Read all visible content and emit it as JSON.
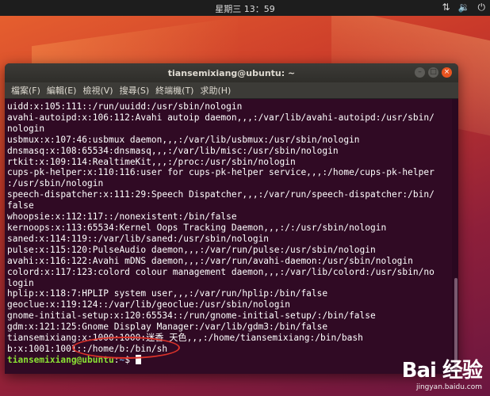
{
  "topbar": {
    "clock": "星期三 13：59",
    "tray": [
      "network-icon",
      "volume-icon",
      "power-icon"
    ]
  },
  "window": {
    "title": "tiansemixiang@ubuntu: ~",
    "buttons": [
      "minimize",
      "maximize",
      "close"
    ],
    "menu": [
      "檔案(F)",
      "編輯(E)",
      "檢視(V)",
      "搜尋(S)",
      "終端機(T)",
      "求助(H)"
    ]
  },
  "terminal": {
    "lines": [
      "uidd:x:105:111::/run/uuidd:/usr/sbin/nologin",
      "avahi-autoipd:x:106:112:Avahi autoip daemon,,,:/var/lib/avahi-autoipd:/usr/sbin/",
      "nologin",
      "usbmux:x:107:46:usbmux daemon,,,:/var/lib/usbmux:/usr/sbin/nologin",
      "dnsmasq:x:108:65534:dnsmasq,,,:/var/lib/misc:/usr/sbin/nologin",
      "rtkit:x:109:114:RealtimeKit,,,:/proc:/usr/sbin/nologin",
      "cups-pk-helper:x:110:116:user for cups-pk-helper service,,,:/home/cups-pk-helper",
      ":/usr/sbin/nologin",
      "speech-dispatcher:x:111:29:Speech Dispatcher,,,:/var/run/speech-dispatcher:/bin/",
      "false",
      "whoopsie:x:112:117::/nonexistent:/bin/false",
      "kernoops:x:113:65534:Kernel Oops Tracking Daemon,,,:/:/usr/sbin/nologin",
      "saned:x:114:119::/var/lib/saned:/usr/sbin/nologin",
      "pulse:x:115:120:PulseAudio daemon,,,:/var/run/pulse:/usr/sbin/nologin",
      "avahi:x:116:122:Avahi mDNS daemon,,,:/var/run/avahi-daemon:/usr/sbin/nologin",
      "colord:x:117:123:colord colour management daemon,,,:/var/lib/colord:/usr/sbin/no",
      "login",
      "hplip:x:118:7:HPLIP system user,,,:/var/run/hplip:/bin/false",
      "geoclue:x:119:124::/var/lib/geoclue:/usr/sbin/nologin",
      "gnome-initial-setup:x:120:65534::/run/gnome-initial-setup/:/bin/false",
      "gdm:x:121:125:Gnome Display Manager:/var/lib/gdm3:/bin/false",
      "tiansemixiang:x:1000:1000:迷香 天色,,,:/home/tiansemixiang:/bin/bash",
      "b:x:1001:1001::/home/b:/bin/sh"
    ],
    "prompt_user": "tiansemixiang@ubuntu",
    "prompt_sep": ":",
    "prompt_path": "~",
    "prompt_symbol": "$ "
  },
  "watermark": {
    "brand": "Bai 经验",
    "site": "jingyan.baidu.com"
  },
  "colors": {
    "terminal_bg": "#300a24",
    "prompt_user": "#8ae234",
    "prompt_path": "#729fcf",
    "close_button": "#e95420",
    "annotation_ring": "#d9322a"
  }
}
